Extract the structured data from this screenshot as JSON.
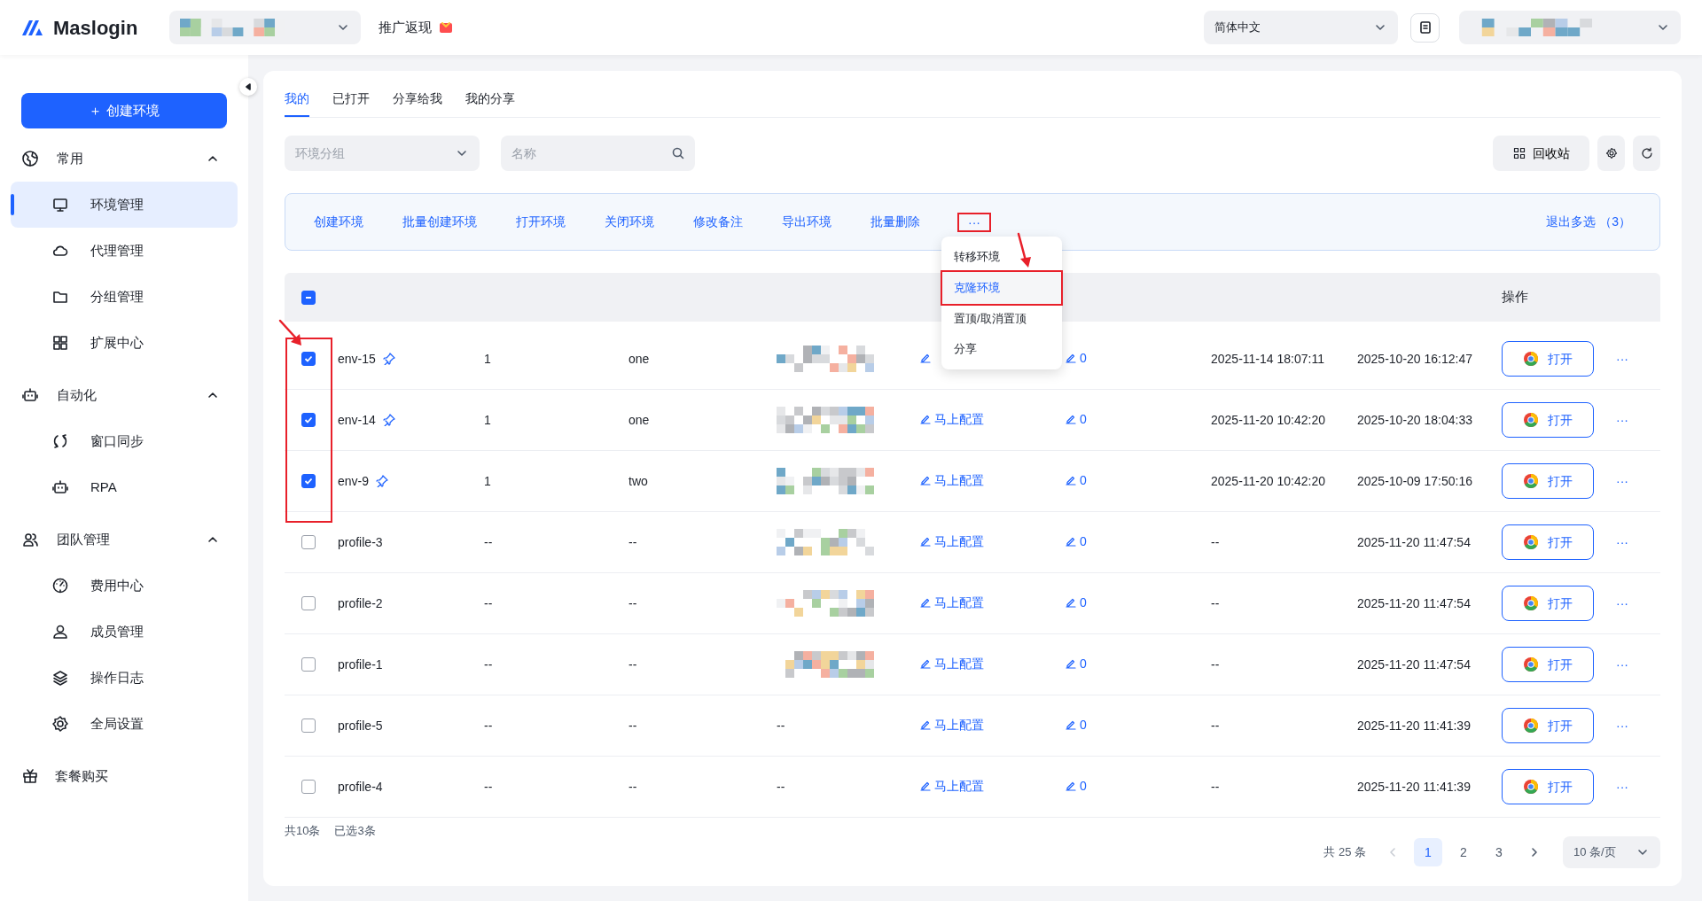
{
  "header": {
    "logo": "Maslogin",
    "workspace": {
      "kind": "redacted"
    },
    "promo": "推广返现",
    "language": "简体中文",
    "account": {
      "kind": "redacted"
    }
  },
  "sidebar": {
    "create_button": "＋ 创建环境",
    "groups": [
      {
        "label": "常用",
        "expanded": true,
        "items": [
          {
            "label": "环境管理",
            "selected": true
          },
          {
            "label": "代理管理",
            "selected": false
          },
          {
            "label": "分组管理",
            "selected": false
          },
          {
            "label": "扩展中心",
            "selected": false
          }
        ]
      },
      {
        "label": "自动化",
        "expanded": true,
        "items": [
          {
            "label": "窗口同步",
            "selected": false
          },
          {
            "label": "RPA",
            "selected": false
          }
        ]
      },
      {
        "label": "团队管理",
        "expanded": true,
        "items": [
          {
            "label": "费用中心",
            "selected": false
          },
          {
            "label": "成员管理",
            "selected": false
          },
          {
            "label": "操作日志",
            "selected": false
          },
          {
            "label": "全局设置",
            "selected": false
          }
        ]
      }
    ],
    "footer_item": {
      "label": "套餐购买"
    }
  },
  "tabs": [
    {
      "label": "我的",
      "selected": true
    },
    {
      "label": "已打开",
      "selected": false
    },
    {
      "label": "分享给我",
      "selected": false
    },
    {
      "label": "我的分享",
      "selected": false
    }
  ],
  "filters": {
    "group": {
      "placeholder": "环境分组"
    },
    "name": {
      "placeholder": "名称"
    },
    "recycle_button": "回收站"
  },
  "batch_bar": {
    "actions": [
      "创建环境",
      "批量创建环境",
      "打开环境",
      "关闭环境",
      "修改备注",
      "导出环境",
      "批量删除"
    ],
    "more": {
      "label": "···",
      "annotated": true
    },
    "exit": "退出多选 （3）"
  },
  "more_menu": {
    "items": [
      {
        "label": "转移环境",
        "selected": false,
        "annotated": false
      },
      {
        "label": "克隆环境",
        "selected": true,
        "annotated": true
      },
      {
        "label": "置顶/取消置顶",
        "selected": false,
        "annotated": false
      },
      {
        "label": "分享",
        "selected": false,
        "annotated": false
      }
    ]
  },
  "table": {
    "header_checkbox": {
      "indeterminate": true
    },
    "action_header": "操作",
    "checkbox_annotated": true,
    "rows": [
      {
        "checked": true,
        "name": "env-15",
        "pinned": true,
        "column_3": "1",
        "column_4": "one",
        "column_5": {
          "kind": "redacted"
        },
        "column_7": "0",
        "column_8": "2025-11-14 18:07:11",
        "column_9": "2025-10-20 16:12:47",
        "open_button": "打开",
        "more": "···"
      },
      {
        "checked": true,
        "name": "env-14",
        "pinned": true,
        "column_3": "1",
        "column_4": "one",
        "column_5": {
          "kind": "redacted"
        },
        "column_6": "马上配置",
        "column_7": "0",
        "column_8": "2025-11-20 10:42:20",
        "column_9": "2025-10-20 18:04:33",
        "open_button": "打开",
        "more": "···"
      },
      {
        "checked": true,
        "name": "env-9",
        "pinned": true,
        "column_3": "1",
        "column_4": "two",
        "column_5": {
          "kind": "redacted"
        },
        "column_6": "马上配置",
        "column_7": "0",
        "column_8": "2025-11-20 10:42:20",
        "column_9": "2025-10-09 17:50:16",
        "open_button": "打开",
        "more": "···"
      },
      {
        "checked": false,
        "name": "profile-3",
        "pinned": false,
        "column_3": "--",
        "column_4": "--",
        "column_5": {
          "kind": "redacted"
        },
        "column_6": "马上配置",
        "column_7": "0",
        "column_8": "--",
        "column_9": "2025-11-20 11:47:54",
        "open_button": "打开",
        "more": "···"
      },
      {
        "checked": false,
        "name": "profile-2",
        "pinned": false,
        "column_3": "--",
        "column_4": "--",
        "column_5": {
          "kind": "redacted"
        },
        "column_6": "马上配置",
        "column_7": "0",
        "column_8": "--",
        "column_9": "2025-11-20 11:47:54",
        "open_button": "打开",
        "more": "···"
      },
      {
        "checked": false,
        "name": "profile-1",
        "pinned": false,
        "column_3": "--",
        "column_4": "--",
        "column_5": {
          "kind": "redacted"
        },
        "column_6": "马上配置",
        "column_7": "0",
        "column_8": "--",
        "column_9": "2025-11-20 11:47:54",
        "open_button": "打开",
        "more": "···"
      },
      {
        "checked": false,
        "name": "profile-5",
        "pinned": false,
        "column_3": "--",
        "column_4": "--",
        "column_5": {
          "kind": "text",
          "text": "--"
        },
        "column_6": "马上配置",
        "column_7": "0",
        "column_8": "--",
        "column_9": "2025-11-20 11:41:39",
        "open_button": "打开",
        "more": "···"
      },
      {
        "checked": false,
        "name": "profile-4",
        "pinned": false,
        "column_3": "--",
        "column_4": "--",
        "column_5": {
          "kind": "text",
          "text": "--"
        },
        "column_6": "马上配置",
        "column_7": "0",
        "column_8": "--",
        "column_9": "2025-11-20 11:41:39",
        "open_button": "打开",
        "more": "···"
      }
    ]
  },
  "footer": {
    "summary": "共10条",
    "selected": "已选3条",
    "total": "共 25 条",
    "prev": {
      "disabled": true
    },
    "next": {
      "disabled": false
    },
    "pages": [
      {
        "label": "1",
        "selected": true
      },
      {
        "label": "2",
        "selected": false
      },
      {
        "label": "3",
        "selected": false
      }
    ],
    "page_size": "10 条/页"
  }
}
